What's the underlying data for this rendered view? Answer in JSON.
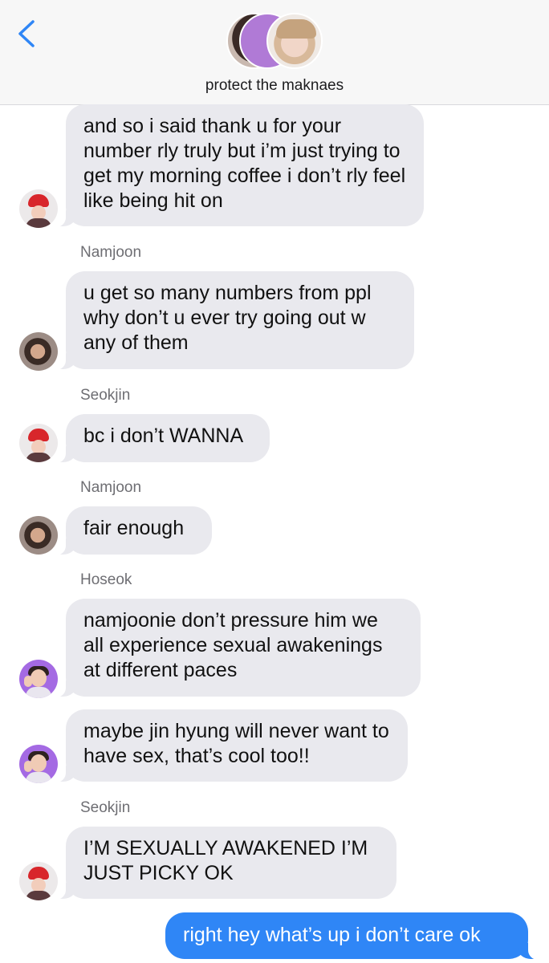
{
  "header": {
    "group_name": "protect the maknaes",
    "back_icon": "chevron-left-icon",
    "accent_color": "#2f86f6"
  },
  "messages": [
    {
      "sender": "",
      "avatar": "seokjin",
      "text": "and so i said thank u for your number rly truly but i’m just trying to get my morning coffee i don’t rly feel like being hit on",
      "direction": "incoming"
    },
    {
      "sender": "Namjoon",
      "avatar": "namjoon",
      "text": "u get so many numbers from ppl why don’t u ever try going out w any of them",
      "direction": "incoming"
    },
    {
      "sender": "Seokjin",
      "avatar": "seokjin",
      "text": "bc i don’t WANNA",
      "direction": "incoming"
    },
    {
      "sender": "Namjoon",
      "avatar": "namjoon",
      "text": "fair enough",
      "direction": "incoming"
    },
    {
      "sender": "Hoseok",
      "avatar": "hoseok",
      "text": "namjoonie don’t pressure him we all experience sexual awakenings at different paces",
      "direction": "incoming"
    },
    {
      "sender": "",
      "avatar": "hoseok",
      "text": "maybe jin hyung will never want to have sex, that’s cool too!!",
      "direction": "incoming"
    },
    {
      "sender": "Seokjin",
      "avatar": "seokjin",
      "text": "I’M SEXUALLY AWAKENED I’M JUST PICKY OK",
      "direction": "incoming"
    },
    {
      "sender": "",
      "avatar": "",
      "text": "right hey what’s up i don’t care ok",
      "direction": "outgoing"
    }
  ],
  "colors": {
    "incoming_bubble": "#e9e9ee",
    "outgoing_bubble": "#2f86f6",
    "header_bg": "#f7f7f7"
  }
}
